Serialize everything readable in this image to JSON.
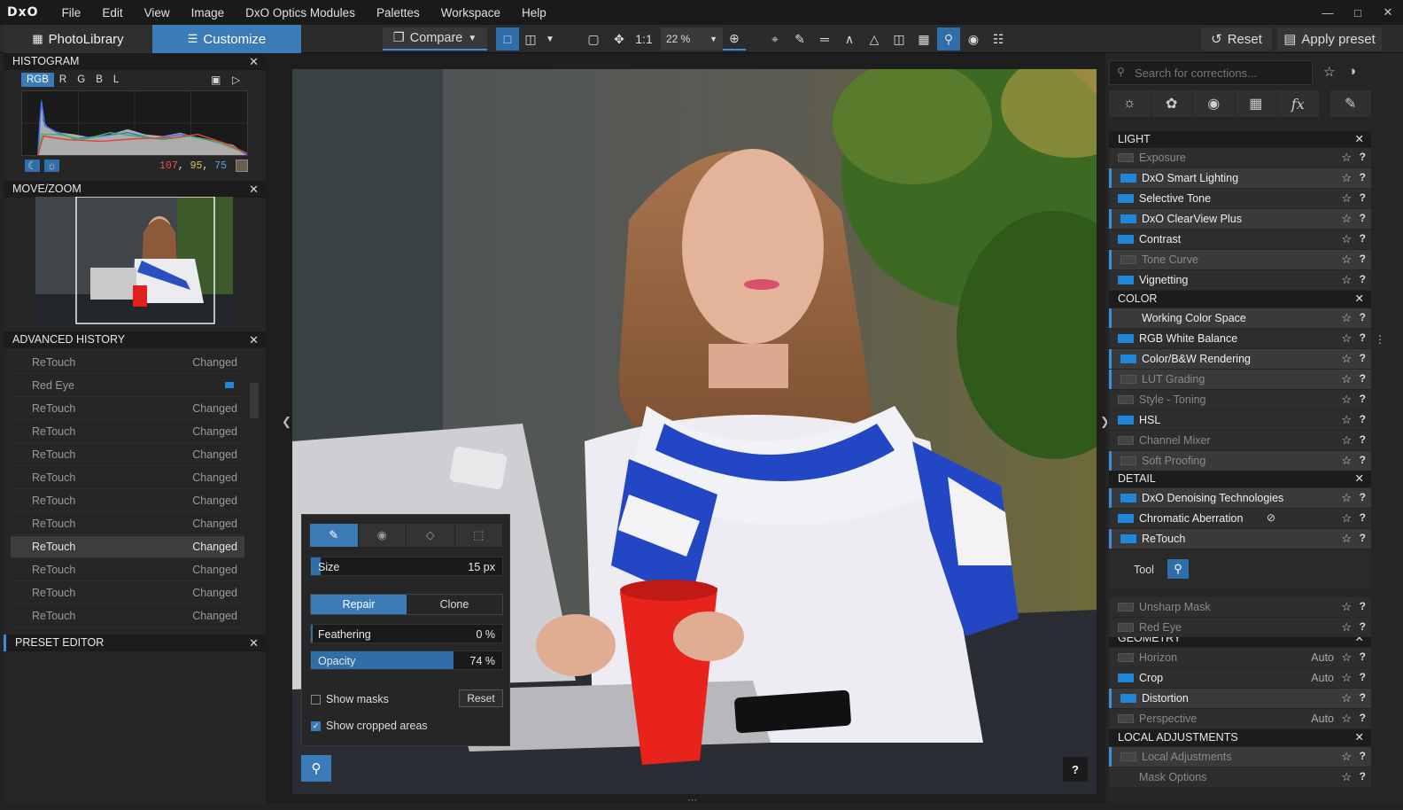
{
  "menubar": {
    "logo": "DxO",
    "items": [
      "File",
      "Edit",
      "View",
      "Image",
      "DxO Optics Modules",
      "Palettes",
      "Workspace",
      "Help"
    ]
  },
  "toolbar": {
    "tab_photolibrary": "PhotoLibrary",
    "tab_customize": "Customize",
    "compare": "Compare",
    "one_to_one": "1:1",
    "zoom": "22 %",
    "reset": "Reset",
    "apply_preset": "Apply preset"
  },
  "left": {
    "histogram_title": "HISTOGRAM",
    "hist_tabs": [
      "RGB",
      "R",
      "G",
      "B",
      "L"
    ],
    "rgb_values": {
      "r": "107",
      "g": "95",
      "b": "75"
    },
    "movezoom_title": "MOVE/ZOOM",
    "history_title": "ADVANCED HISTORY",
    "history": [
      {
        "action": "ReTouch",
        "status": "Changed"
      },
      {
        "action": "Red Eye",
        "status": ""
      },
      {
        "action": "ReTouch",
        "status": "Changed"
      },
      {
        "action": "ReTouch",
        "status": "Changed"
      },
      {
        "action": "ReTouch",
        "status": "Changed"
      },
      {
        "action": "ReTouch",
        "status": "Changed"
      },
      {
        "action": "ReTouch",
        "status": "Changed"
      },
      {
        "action": "ReTouch",
        "status": "Changed"
      },
      {
        "action": "ReTouch",
        "status": "Changed"
      },
      {
        "action": "ReTouch",
        "status": "Changed"
      },
      {
        "action": "ReTouch",
        "status": "Changed"
      },
      {
        "action": "ReTouch",
        "status": "Changed"
      }
    ],
    "preset_title": "PRESET EDITOR"
  },
  "retouch": {
    "size_label": "Size",
    "size_value": "15 px",
    "size_level": 0.05,
    "repair": "Repair",
    "clone": "Clone",
    "feather_label": "Feathering",
    "feather_value": "0 %",
    "opacity_label": "Opacity",
    "opacity_value": "74 %",
    "opacity_level": 0.74,
    "show_masks": "Show masks",
    "show_cropped": "Show cropped areas",
    "reset": "Reset"
  },
  "right": {
    "search_placeholder": "Search for corrections...",
    "sections": [
      {
        "title": "LIGHT",
        "items": [
          {
            "name": "Exposure",
            "on": false,
            "hl": false
          },
          {
            "name": "DxO Smart Lighting",
            "on": true,
            "hl": true
          },
          {
            "name": "Selective Tone",
            "on": true,
            "hl": false
          },
          {
            "name": "DxO ClearView Plus",
            "on": true,
            "hl": true
          },
          {
            "name": "Contrast",
            "on": true,
            "hl": false
          },
          {
            "name": "Tone Curve",
            "on": false,
            "hl": true
          },
          {
            "name": "Vignetting",
            "on": true,
            "hl": false
          }
        ]
      },
      {
        "title": "COLOR",
        "items": [
          {
            "name": "Working Color Space",
            "on": true,
            "hl": true,
            "nosw": true
          },
          {
            "name": "RGB White Balance",
            "on": true,
            "hl": false
          },
          {
            "name": "Color/B&W Rendering",
            "on": true,
            "hl": true
          },
          {
            "name": "LUT Grading",
            "on": false,
            "hl": true
          },
          {
            "name": "Style - Toning",
            "on": false,
            "hl": false
          },
          {
            "name": "HSL",
            "on": true,
            "hl": false
          },
          {
            "name": "Channel Mixer",
            "on": false,
            "hl": false
          },
          {
            "name": "Soft Proofing",
            "on": false,
            "hl": true
          }
        ]
      },
      {
        "title": "DETAIL",
        "items": [
          {
            "name": "DxO Denoising Technologies",
            "on": true,
            "hl": true
          },
          {
            "name": "Chromatic Aberration",
            "on": true,
            "hl": false
          },
          {
            "name": "ReTouch",
            "on": true,
            "hl": true
          }
        ]
      },
      {
        "title": "GEOMETRY",
        "items": [
          {
            "name": "Horizon",
            "on": false,
            "hl": false,
            "auto": "Auto"
          },
          {
            "name": "Crop",
            "on": true,
            "hl": false,
            "auto": "Auto"
          },
          {
            "name": "Distortion",
            "on": true,
            "hl": true
          },
          {
            "name": "Perspective",
            "on": false,
            "hl": false,
            "auto": "Auto"
          }
        ]
      },
      {
        "title": "LOCAL ADJUSTMENTS",
        "items": [
          {
            "name": "Local Adjustments",
            "on": false,
            "hl": true
          },
          {
            "name": "Mask Options",
            "on": false,
            "hl": false,
            "nosw": true
          }
        ]
      }
    ],
    "detail_extra": [
      {
        "name": "Unsharp Mask",
        "on": false
      },
      {
        "name": "Red Eye",
        "on": false
      }
    ],
    "tool_label": "Tool"
  },
  "viewer": {
    "help": "?"
  }
}
